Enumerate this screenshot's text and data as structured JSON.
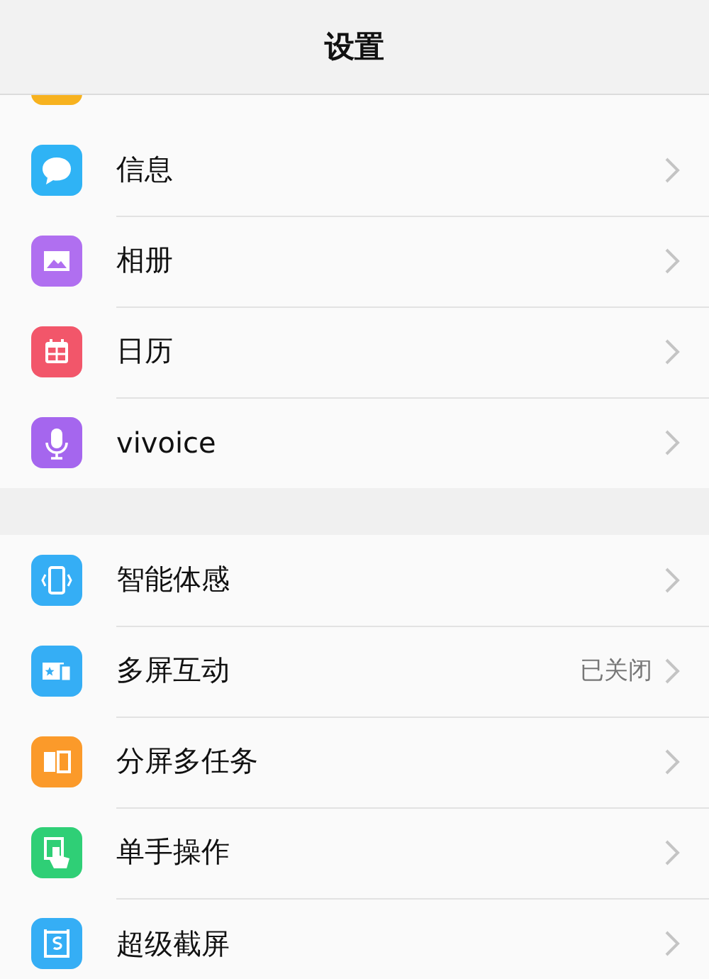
{
  "header": {
    "title": "设置"
  },
  "sections": [
    {
      "items": [
        {
          "kind": "partial",
          "color": "#f7b21f"
        },
        {
          "kind": "row",
          "label": "信息",
          "color": "#2fb3f5"
        },
        {
          "kind": "row",
          "label": "相册",
          "color": "#b06ff0"
        },
        {
          "kind": "row",
          "label": "日历",
          "color": "#f2566a"
        },
        {
          "kind": "row",
          "label": "vivoice",
          "color": "#a566ee"
        }
      ]
    },
    {
      "items": [
        {
          "kind": "row",
          "label": "智能体感",
          "color": "#35aef5"
        },
        {
          "kind": "row",
          "label": "多屏互动",
          "value": "已关闭",
          "color": "#35aef5"
        },
        {
          "kind": "row",
          "label": "分屏多任务",
          "color": "#fb9a2a"
        },
        {
          "kind": "row",
          "label": "单手操作",
          "color": "#2fcf76"
        },
        {
          "kind": "row",
          "label": "超级截屏",
          "color": "#35aef5"
        }
      ]
    }
  ]
}
